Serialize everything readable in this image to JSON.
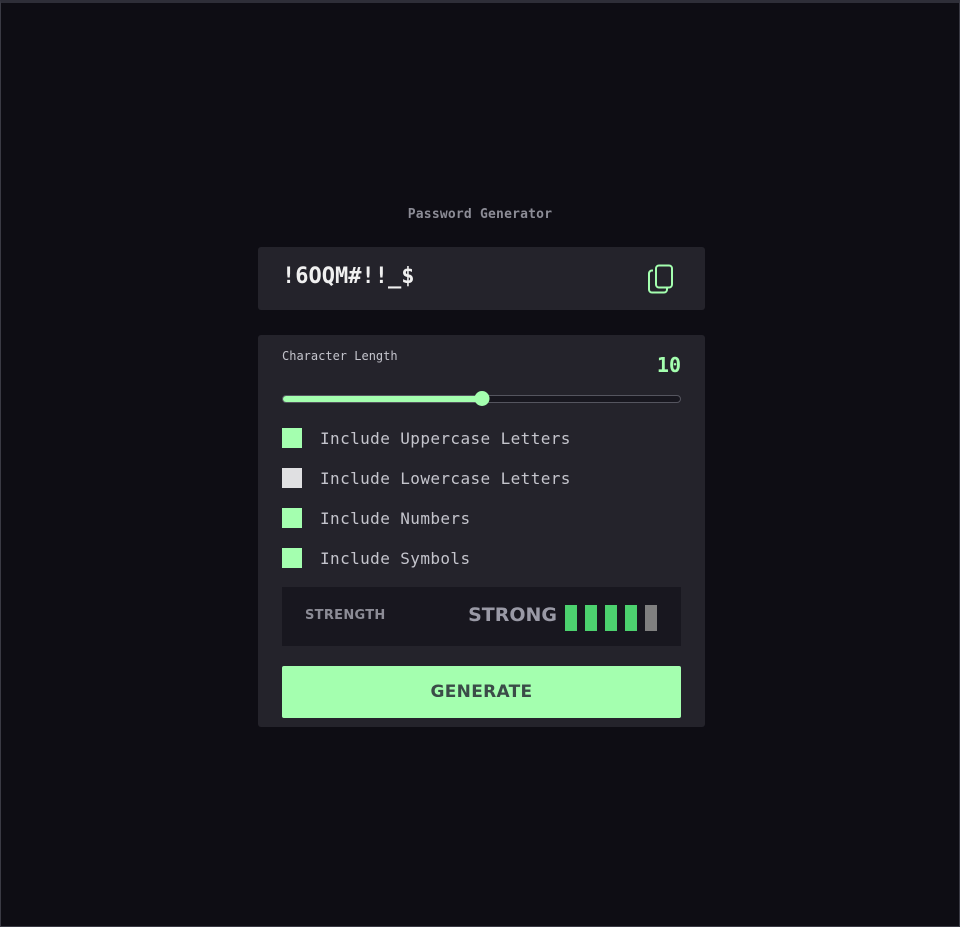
{
  "app": {
    "title": "Password Generator"
  },
  "password": {
    "value": "!6OQM#!!_$",
    "copy_icon": "copy-icon"
  },
  "length": {
    "label": "Character Length",
    "value": "10",
    "slider_fraction": 0.5
  },
  "options": [
    {
      "label": "Include Uppercase Letters",
      "checked": true
    },
    {
      "label": "Include Lowercase Letters",
      "checked": false
    },
    {
      "label": "Include Numbers",
      "checked": true
    },
    {
      "label": "Include Symbols",
      "checked": true
    }
  ],
  "strength": {
    "label": "STRENGTH",
    "value": "STRONG",
    "level": 4,
    "max": 5
  },
  "generate": {
    "label": "GENERATE"
  },
  "colors": {
    "accent": "#a4ffaf",
    "strength_bar_active": "#4cd26f",
    "strength_bar_inactive": "#808080",
    "background": "#0e0d14",
    "panel": "#24232b"
  }
}
